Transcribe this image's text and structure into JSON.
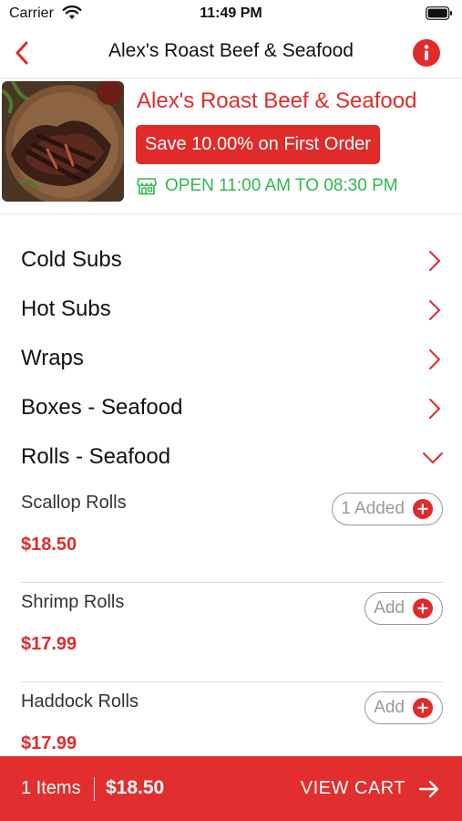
{
  "status_bar": {
    "carrier": "Carrier",
    "time": "11:49 PM"
  },
  "nav": {
    "title": "Alex's Roast Beef & Seafood",
    "back_icon": "chevron-left-icon",
    "info_icon": "info-icon"
  },
  "restaurant": {
    "name": "Alex's Roast Beef & Seafood",
    "promo": "Save 10.00% on First Order",
    "hours": "OPEN 11:00 AM TO 08:30 PM"
  },
  "categories": [
    {
      "label": "Cold Subs",
      "expanded": false
    },
    {
      "label": "Hot Subs",
      "expanded": false
    },
    {
      "label": "Wraps",
      "expanded": false
    },
    {
      "label": "Boxes - Seafood",
      "expanded": false
    },
    {
      "label": "Rolls - Seafood",
      "expanded": true
    }
  ],
  "menu_items": [
    {
      "name": "Scallop Rolls",
      "price": "$18.50",
      "button": "1 Added"
    },
    {
      "name": "Shrimp Rolls",
      "price": "$17.99",
      "button": "Add"
    },
    {
      "name": "Haddock Rolls",
      "price": "$17.99",
      "button": "Add"
    }
  ],
  "cart": {
    "count": "1 Items",
    "total": "$18.50",
    "action": "VIEW CART"
  },
  "colors": {
    "accent": "#e12b2b",
    "open_green": "#2fb84c"
  }
}
